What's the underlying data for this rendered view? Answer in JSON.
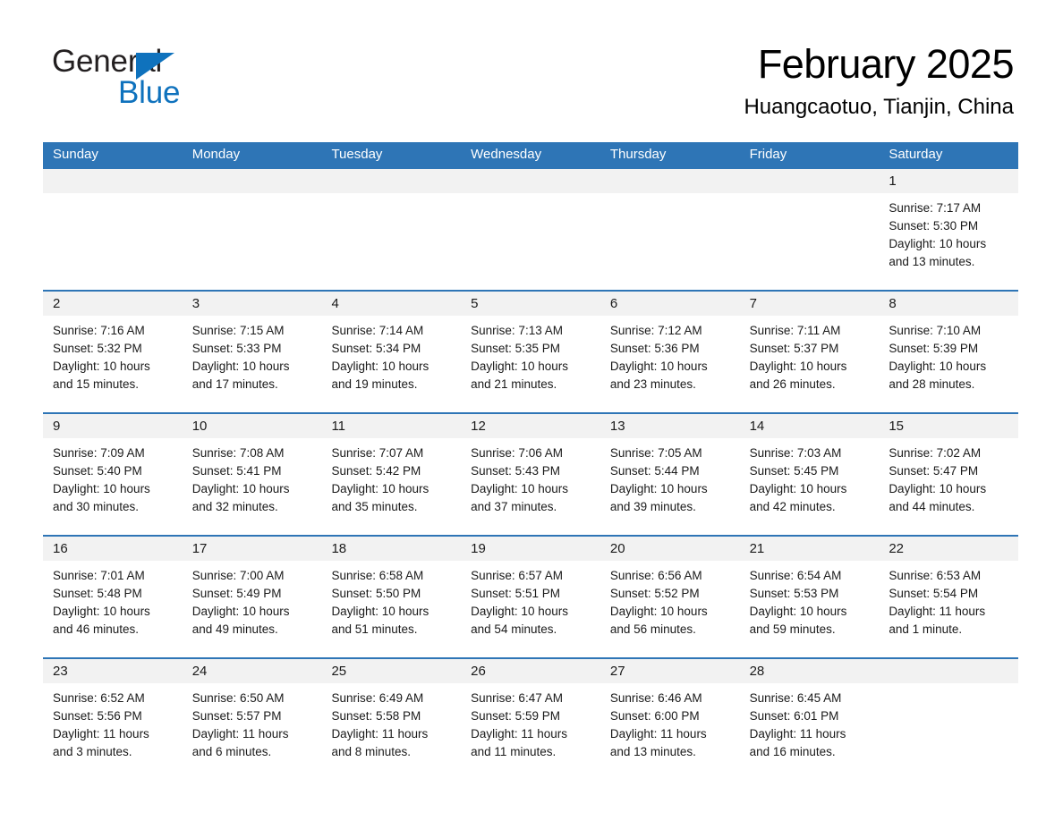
{
  "brand": {
    "name_part1": "General",
    "name_part2": "Blue",
    "triangle_color": "#0f72bd"
  },
  "header": {
    "month_title": "February 2025",
    "location": "Huangcaotuo, Tianjin, China"
  },
  "theme": {
    "header_blue": "#2e75b6",
    "date_band_gray": "#f2f2f2",
    "text_color": "#1a1a1a"
  },
  "weekdays": [
    "Sunday",
    "Monday",
    "Tuesday",
    "Wednesday",
    "Thursday",
    "Friday",
    "Saturday"
  ],
  "weeks": [
    {
      "dates": [
        "",
        "",
        "",
        "",
        "",
        "",
        "1"
      ],
      "cells": [
        {
          "sunrise": "",
          "sunset": "",
          "daylight1": "",
          "daylight2": ""
        },
        {
          "sunrise": "",
          "sunset": "",
          "daylight1": "",
          "daylight2": ""
        },
        {
          "sunrise": "",
          "sunset": "",
          "daylight1": "",
          "daylight2": ""
        },
        {
          "sunrise": "",
          "sunset": "",
          "daylight1": "",
          "daylight2": ""
        },
        {
          "sunrise": "",
          "sunset": "",
          "daylight1": "",
          "daylight2": ""
        },
        {
          "sunrise": "",
          "sunset": "",
          "daylight1": "",
          "daylight2": ""
        },
        {
          "sunrise": "Sunrise: 7:17 AM",
          "sunset": "Sunset: 5:30 PM",
          "daylight1": "Daylight: 10 hours",
          "daylight2": "and 13 minutes."
        }
      ]
    },
    {
      "dates": [
        "2",
        "3",
        "4",
        "5",
        "6",
        "7",
        "8"
      ],
      "cells": [
        {
          "sunrise": "Sunrise: 7:16 AM",
          "sunset": "Sunset: 5:32 PM",
          "daylight1": "Daylight: 10 hours",
          "daylight2": "and 15 minutes."
        },
        {
          "sunrise": "Sunrise: 7:15 AM",
          "sunset": "Sunset: 5:33 PM",
          "daylight1": "Daylight: 10 hours",
          "daylight2": "and 17 minutes."
        },
        {
          "sunrise": "Sunrise: 7:14 AM",
          "sunset": "Sunset: 5:34 PM",
          "daylight1": "Daylight: 10 hours",
          "daylight2": "and 19 minutes."
        },
        {
          "sunrise": "Sunrise: 7:13 AM",
          "sunset": "Sunset: 5:35 PM",
          "daylight1": "Daylight: 10 hours",
          "daylight2": "and 21 minutes."
        },
        {
          "sunrise": "Sunrise: 7:12 AM",
          "sunset": "Sunset: 5:36 PM",
          "daylight1": "Daylight: 10 hours",
          "daylight2": "and 23 minutes."
        },
        {
          "sunrise": "Sunrise: 7:11 AM",
          "sunset": "Sunset: 5:37 PM",
          "daylight1": "Daylight: 10 hours",
          "daylight2": "and 26 minutes."
        },
        {
          "sunrise": "Sunrise: 7:10 AM",
          "sunset": "Sunset: 5:39 PM",
          "daylight1": "Daylight: 10 hours",
          "daylight2": "and 28 minutes."
        }
      ]
    },
    {
      "dates": [
        "9",
        "10",
        "11",
        "12",
        "13",
        "14",
        "15"
      ],
      "cells": [
        {
          "sunrise": "Sunrise: 7:09 AM",
          "sunset": "Sunset: 5:40 PM",
          "daylight1": "Daylight: 10 hours",
          "daylight2": "and 30 minutes."
        },
        {
          "sunrise": "Sunrise: 7:08 AM",
          "sunset": "Sunset: 5:41 PM",
          "daylight1": "Daylight: 10 hours",
          "daylight2": "and 32 minutes."
        },
        {
          "sunrise": "Sunrise: 7:07 AM",
          "sunset": "Sunset: 5:42 PM",
          "daylight1": "Daylight: 10 hours",
          "daylight2": "and 35 minutes."
        },
        {
          "sunrise": "Sunrise: 7:06 AM",
          "sunset": "Sunset: 5:43 PM",
          "daylight1": "Daylight: 10 hours",
          "daylight2": "and 37 minutes."
        },
        {
          "sunrise": "Sunrise: 7:05 AM",
          "sunset": "Sunset: 5:44 PM",
          "daylight1": "Daylight: 10 hours",
          "daylight2": "and 39 minutes."
        },
        {
          "sunrise": "Sunrise: 7:03 AM",
          "sunset": "Sunset: 5:45 PM",
          "daylight1": "Daylight: 10 hours",
          "daylight2": "and 42 minutes."
        },
        {
          "sunrise": "Sunrise: 7:02 AM",
          "sunset": "Sunset: 5:47 PM",
          "daylight1": "Daylight: 10 hours",
          "daylight2": "and 44 minutes."
        }
      ]
    },
    {
      "dates": [
        "16",
        "17",
        "18",
        "19",
        "20",
        "21",
        "22"
      ],
      "cells": [
        {
          "sunrise": "Sunrise: 7:01 AM",
          "sunset": "Sunset: 5:48 PM",
          "daylight1": "Daylight: 10 hours",
          "daylight2": "and 46 minutes."
        },
        {
          "sunrise": "Sunrise: 7:00 AM",
          "sunset": "Sunset: 5:49 PM",
          "daylight1": "Daylight: 10 hours",
          "daylight2": "and 49 minutes."
        },
        {
          "sunrise": "Sunrise: 6:58 AM",
          "sunset": "Sunset: 5:50 PM",
          "daylight1": "Daylight: 10 hours",
          "daylight2": "and 51 minutes."
        },
        {
          "sunrise": "Sunrise: 6:57 AM",
          "sunset": "Sunset: 5:51 PM",
          "daylight1": "Daylight: 10 hours",
          "daylight2": "and 54 minutes."
        },
        {
          "sunrise": "Sunrise: 6:56 AM",
          "sunset": "Sunset: 5:52 PM",
          "daylight1": "Daylight: 10 hours",
          "daylight2": "and 56 minutes."
        },
        {
          "sunrise": "Sunrise: 6:54 AM",
          "sunset": "Sunset: 5:53 PM",
          "daylight1": "Daylight: 10 hours",
          "daylight2": "and 59 minutes."
        },
        {
          "sunrise": "Sunrise: 6:53 AM",
          "sunset": "Sunset: 5:54 PM",
          "daylight1": "Daylight: 11 hours",
          "daylight2": "and 1 minute."
        }
      ]
    },
    {
      "dates": [
        "23",
        "24",
        "25",
        "26",
        "27",
        "28",
        ""
      ],
      "cells": [
        {
          "sunrise": "Sunrise: 6:52 AM",
          "sunset": "Sunset: 5:56 PM",
          "daylight1": "Daylight: 11 hours",
          "daylight2": "and 3 minutes."
        },
        {
          "sunrise": "Sunrise: 6:50 AM",
          "sunset": "Sunset: 5:57 PM",
          "daylight1": "Daylight: 11 hours",
          "daylight2": "and 6 minutes."
        },
        {
          "sunrise": "Sunrise: 6:49 AM",
          "sunset": "Sunset: 5:58 PM",
          "daylight1": "Daylight: 11 hours",
          "daylight2": "and 8 minutes."
        },
        {
          "sunrise": "Sunrise: 6:47 AM",
          "sunset": "Sunset: 5:59 PM",
          "daylight1": "Daylight: 11 hours",
          "daylight2": "and 11 minutes."
        },
        {
          "sunrise": "Sunrise: 6:46 AM",
          "sunset": "Sunset: 6:00 PM",
          "daylight1": "Daylight: 11 hours",
          "daylight2": "and 13 minutes."
        },
        {
          "sunrise": "Sunrise: 6:45 AM",
          "sunset": "Sunset: 6:01 PM",
          "daylight1": "Daylight: 11 hours",
          "daylight2": "and 16 minutes."
        },
        {
          "sunrise": "",
          "sunset": "",
          "daylight1": "",
          "daylight2": ""
        }
      ]
    }
  ]
}
